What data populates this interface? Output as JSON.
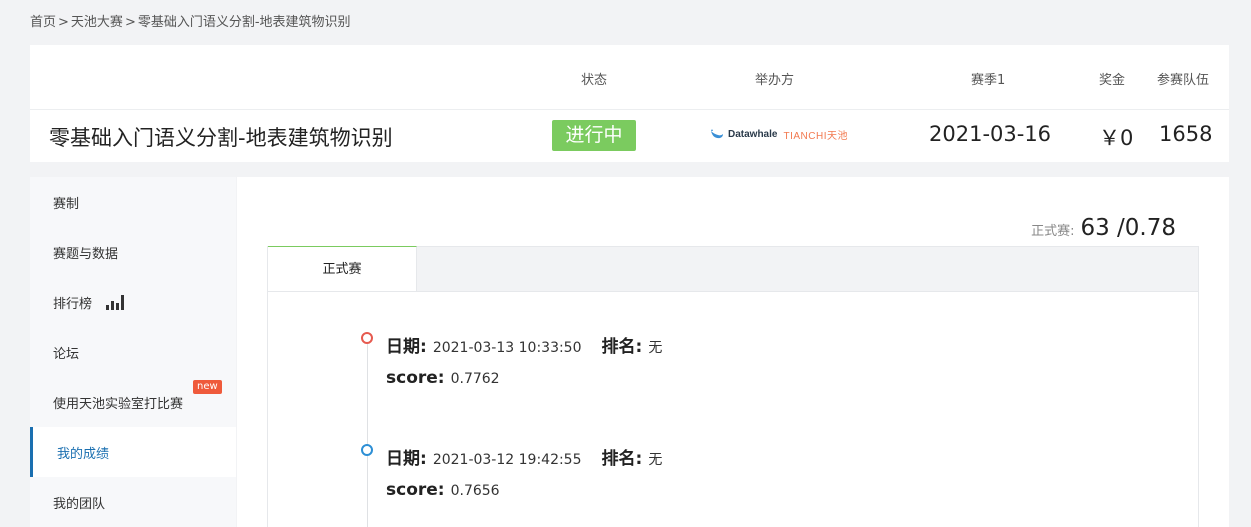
{
  "breadcrumb": {
    "items": [
      "首页",
      "天池大赛",
      "零基础入门语义分割-地表建筑物识别"
    ],
    "separator": ">"
  },
  "header": {
    "labels": {
      "status": "状态",
      "organizer": "举办方",
      "season": "赛季1",
      "prize": "奖金",
      "teams": "参赛队伍"
    },
    "title": "零基础入门语义分割-地表建筑物识别",
    "status": "进行中",
    "organizer_logo": {
      "datawhale": "Datawhale",
      "tianchi": "TIANCHI天池"
    },
    "season_date": "2021-03-16",
    "prize": "￥0",
    "teams": "1658"
  },
  "sidebar": {
    "items": [
      {
        "label": "赛制"
      },
      {
        "label": "赛题与数据"
      },
      {
        "label": "排行榜",
        "icon": "bar-chart-icon"
      },
      {
        "label": "论坛"
      },
      {
        "label": "使用天池实验室打比赛",
        "badge": "new"
      },
      {
        "label": "我的成绩",
        "active": true
      },
      {
        "label": "我的团队"
      }
    ]
  },
  "main": {
    "score_summary": {
      "label": "正式赛:",
      "value": "63 /0.78"
    },
    "tabs": [
      {
        "label": "正式赛",
        "active": true
      }
    ],
    "entries": [
      {
        "date_label": "日期:",
        "date": "2021-03-13 10:33:50",
        "rank_label": "排名:",
        "rank": "无",
        "score_label": "score:",
        "score": "0.7762",
        "dot_color": "#e65a4f"
      },
      {
        "date_label": "日期:",
        "date": "2021-03-12 19:42:55",
        "rank_label": "排名:",
        "rank": "无",
        "score_label": "score:",
        "score": "0.7656",
        "dot_color": "#2d8fd5"
      }
    ]
  },
  "colors": {
    "status_green": "#7bcb5f",
    "accent_blue": "#1a6fb0",
    "badge_red": "#ef5a3b"
  }
}
